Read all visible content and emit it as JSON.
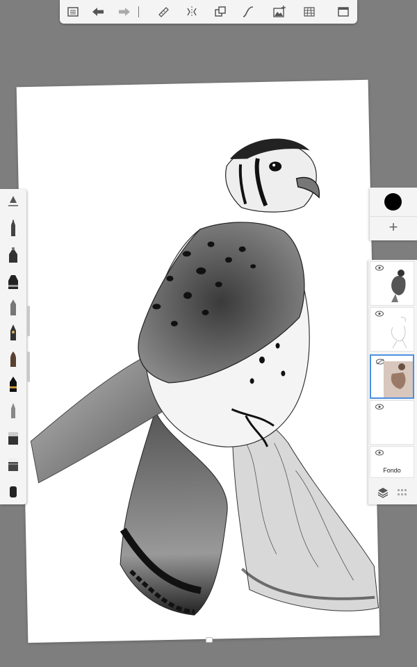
{
  "toolbar": {
    "buttons": [
      {
        "name": "gallery-icon"
      },
      {
        "name": "undo-icon"
      },
      {
        "name": "redo-icon"
      },
      {
        "name": "ruler-icon"
      },
      {
        "name": "symmetry-icon"
      },
      {
        "name": "transform-icon"
      },
      {
        "name": "curve-icon"
      },
      {
        "name": "add-image-icon"
      },
      {
        "name": "perspective-grid-icon"
      },
      {
        "name": "fullscreen-icon"
      }
    ]
  },
  "brushes": [
    "brush-settings-icon",
    "pencil-icon",
    "airbrush-icon",
    "marker-icon",
    "chisel-marker-icon",
    "ink-pen-icon",
    "paint-brush-icon",
    "felt-pen-icon",
    "smudge-icon",
    "eraser-icon",
    "hard-eraser-icon",
    "soft-eraser-icon"
  ],
  "color": {
    "current": "#000000"
  },
  "layers": [
    {
      "name": "layer-kestrel-shaded",
      "label": ""
    },
    {
      "name": "layer-sketch",
      "label": ""
    },
    {
      "name": "layer-reference",
      "label": "",
      "active": true
    },
    {
      "name": "layer-empty",
      "label": ""
    },
    {
      "name": "layer-background",
      "label": "Fondo"
    }
  ],
  "accent": "#4a90e2"
}
